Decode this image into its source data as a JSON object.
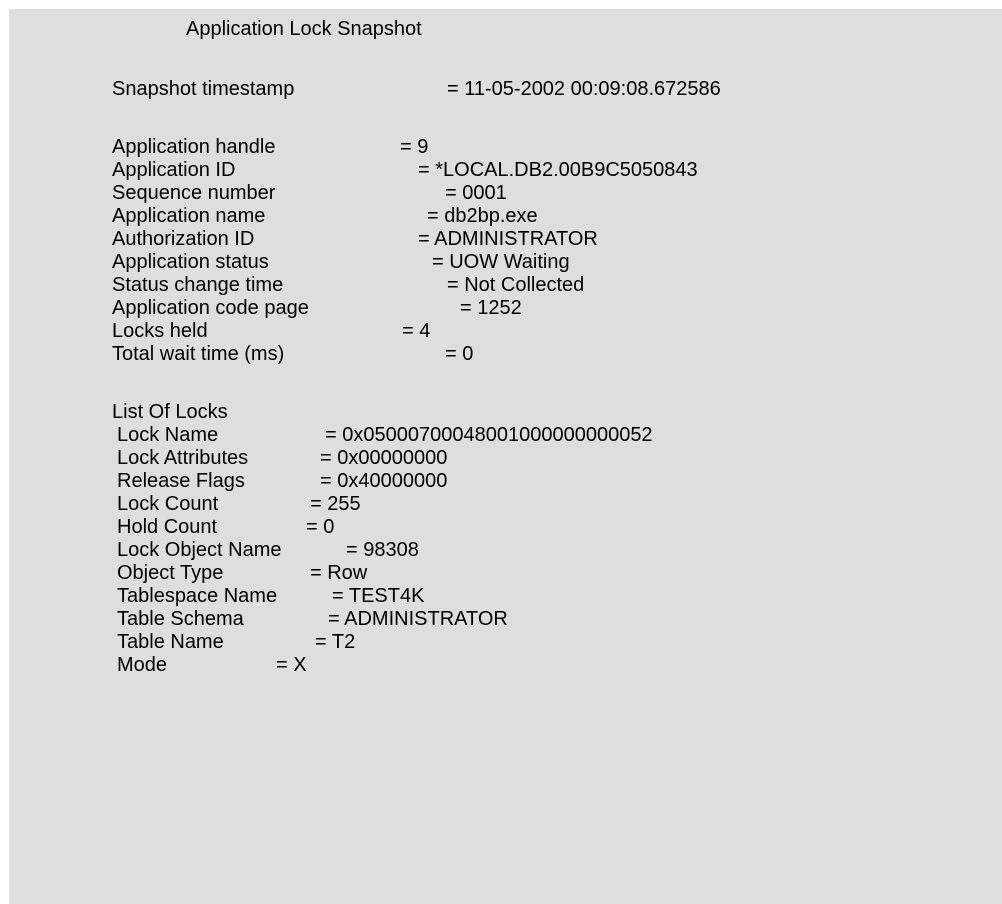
{
  "title": "Application Lock Snapshot",
  "snapshot": {
    "timestamp_label": "Snapshot timestamp",
    "timestamp_value": "= 11-05-2002 00:09:08.672586"
  },
  "application": [
    {
      "label": "Application handle",
      "value": "= 9"
    },
    {
      "label": "Application ID",
      "value": "= *LOCAL.DB2.00B9C5050843"
    },
    {
      "label": "Sequence number",
      "value": "= 0001"
    },
    {
      "label": "Application name",
      "value": "= db2bp.exe"
    },
    {
      "label": "Authorization ID",
      "value": "= ADMINISTRATOR"
    },
    {
      "label": "Application status",
      "value": "= UOW Waiting"
    },
    {
      "label": "Status change time",
      "value": "= Not Collected"
    },
    {
      "label": "Application code page",
      "value": "= 1252"
    },
    {
      "label": "Locks held",
      "value": "= 4"
    },
    {
      "label": "Total wait time (ms)",
      "value": "= 0"
    }
  ],
  "locks": {
    "heading": "List Of Locks",
    "items": [
      {
        "label": "Lock Name",
        "value": "= 0x05000700048001000000000052"
      },
      {
        "label": "Lock Attributes",
        "value": "= 0x00000000"
      },
      {
        "label": "Release Flags",
        "value": "= 0x40000000"
      },
      {
        "label": "Lock Count",
        "value": "= 255"
      },
      {
        "label": "Hold Count",
        "value": "= 0"
      },
      {
        "label": "Lock Object Name",
        "value": "= 98308"
      },
      {
        "label": "Object Type",
        "value": "= Row"
      },
      {
        "label": "Tablespace Name",
        "value": "= TEST4K"
      },
      {
        "label": "Table Schema",
        "value": "= ADMINISTRATOR"
      },
      {
        "label": "Table Name",
        "value": "= T2"
      },
      {
        "label": "Mode",
        "value": "= X"
      }
    ]
  }
}
